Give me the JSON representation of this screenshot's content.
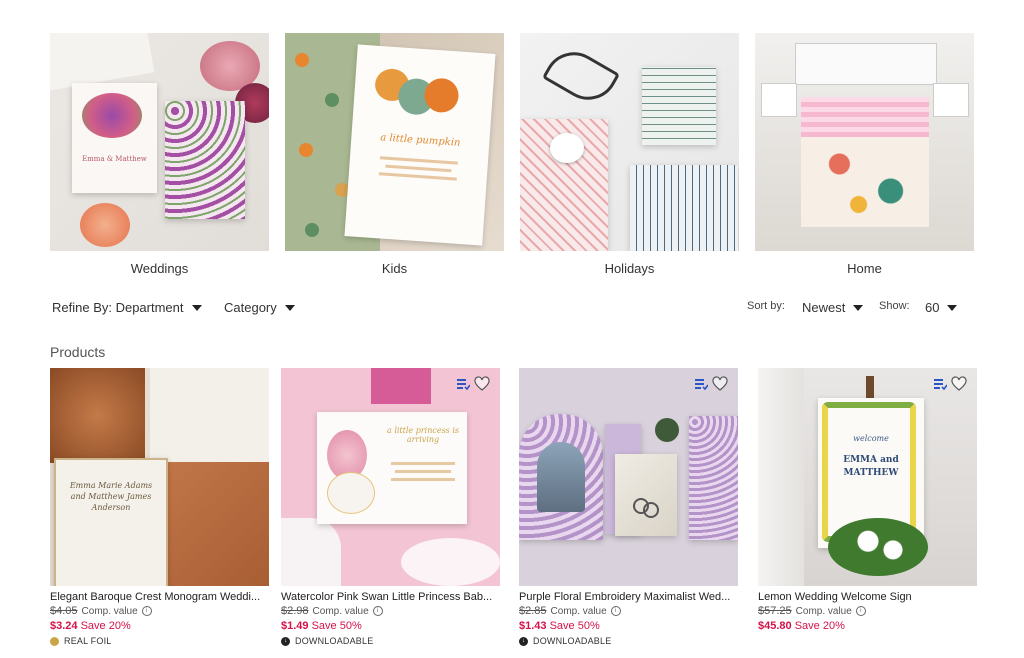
{
  "categories": [
    {
      "label": "Weddings"
    },
    {
      "label": "Kids"
    },
    {
      "label": "Holidays"
    },
    {
      "label": "Home"
    }
  ],
  "filters": {
    "refine_label": "Refine By: Department",
    "category_label": "Category",
    "sort_by_label": "Sort by:",
    "sort_value": "Newest",
    "show_label": "Show:",
    "show_value": "60"
  },
  "products_heading": "Products",
  "products": [
    {
      "title": "Elegant Baroque Crest Monogram Weddi...",
      "old_price": "$4.05",
      "comp_label": "Comp. value",
      "price": "$3.24",
      "save": "Save 20%",
      "badge": "REAL FOIL",
      "badge_icon": "gold-dot-icon"
    },
    {
      "title": "Watercolor Pink Swan Little Princess Bab...",
      "old_price": "$2.98",
      "comp_label": "Comp. value",
      "price": "$1.49",
      "save": "Save 50%",
      "badge": "DOWNLOADABLE",
      "badge_icon": "download-icon"
    },
    {
      "title": "Purple Floral Embroidery Maximalist Wed...",
      "old_price": "$2.85",
      "comp_label": "Comp. value",
      "price": "$1.43",
      "save": "Save 50%",
      "badge": "DOWNLOADABLE",
      "badge_icon": "download-icon"
    },
    {
      "title": "Lemon Wedding Welcome Sign",
      "old_price": "$57.25",
      "comp_label": "Comp. value",
      "price": "$45.80",
      "save": "Save 20%",
      "badge": "",
      "badge_icon": ""
    }
  ],
  "colors": {
    "sale": "#d4124a",
    "accent_blue": "#2a56c6"
  },
  "image_text": {
    "kids_card": "a little pumpkin",
    "wedding_card_names": "Emma & Matthew",
    "lemon_sign": "welcome",
    "lemon_sign_names": "EMMA and MATTHEW",
    "swan_card": "a little princess is arriving",
    "baroque_card": "Emma Marie Adams and Matthew James Anderson"
  }
}
